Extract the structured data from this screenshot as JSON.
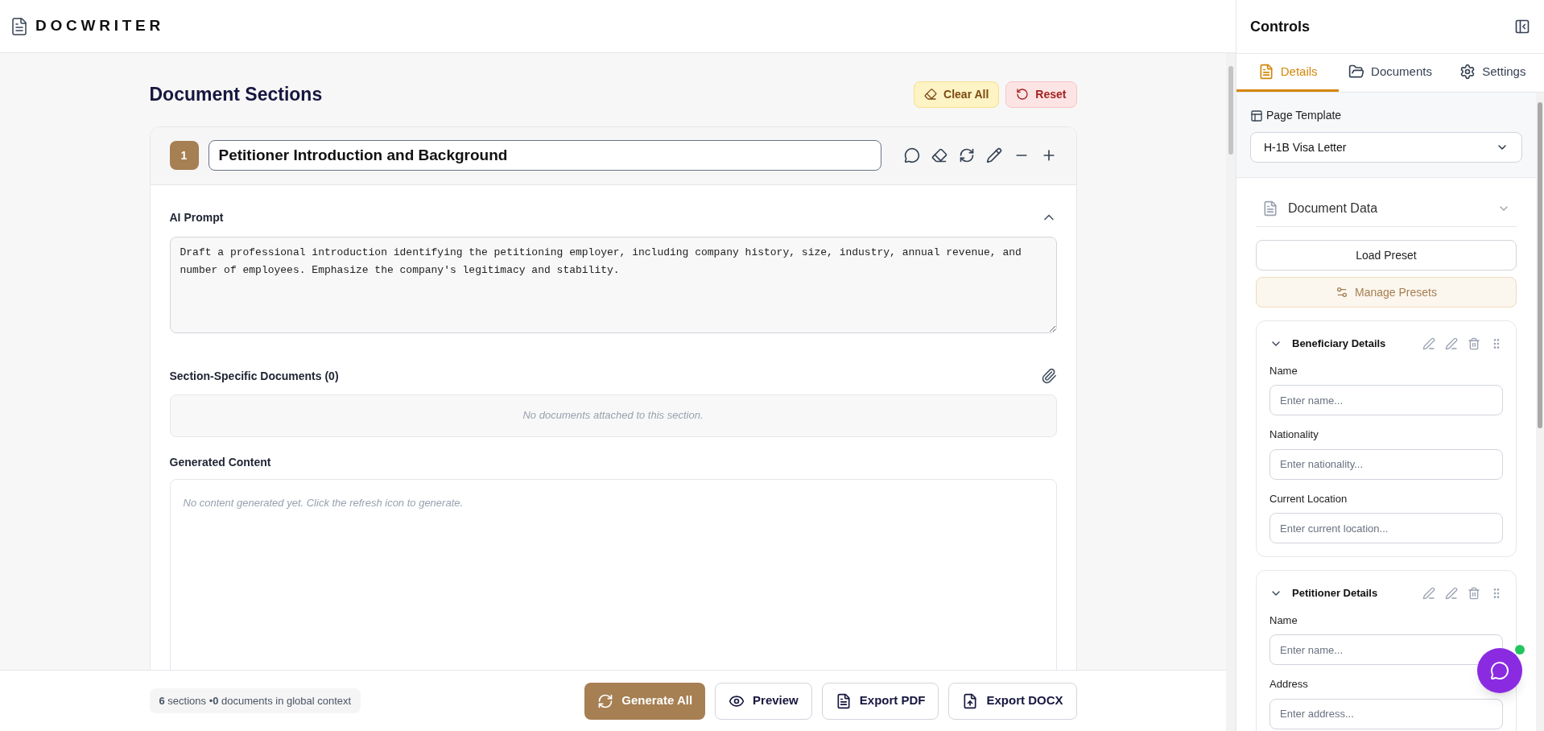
{
  "app": {
    "logo": "DOCWRITER"
  },
  "main": {
    "title": "Document Sections",
    "actions": [
      {
        "label": "Clear All",
        "kind": "clear"
      },
      {
        "label": "Reset",
        "kind": "reset"
      }
    ],
    "sections": [
      {
        "number": "1",
        "title": "Petitioner Introduction and Background",
        "prompt_label": "AI Prompt",
        "prompt_expanded": true,
        "prompt": "Draft a professional introduction identifying the petitioning employer, including company history, size, industry, annual revenue, and number of employees. Emphasize the company's legitimacy and stability.",
        "docs_label": "Section-Specific Documents (0)",
        "docs_empty": "No documents attached to this section.",
        "content_label": "Generated Content",
        "content_placeholder": "No content generated yet. Click the refresh icon to generate."
      }
    ]
  },
  "footer": {
    "summary": "**6** sections •**0** documents in global context",
    "buttons": [
      {
        "label": "Generate All",
        "kind": "generate"
      },
      {
        "label": "Preview",
        "kind": "preview"
      },
      {
        "label": "Export PDF",
        "kind": "pdf"
      },
      {
        "label": "Export DOCX",
        "kind": "docx"
      }
    ]
  },
  "panel": {
    "title": "Controls",
    "tabs": [
      {
        "label": "Details",
        "kind": "details",
        "selected": true
      },
      {
        "label": "Documents",
        "kind": "documents",
        "selected": false
      },
      {
        "label": "Settings",
        "kind": "settings",
        "selected": false
      }
    ],
    "template_label": "Page Template",
    "template_value": "H-1B Visa Letter",
    "data_title": "Document Data",
    "load_preset": "Load Preset",
    "manage_presets": "Manage Presets",
    "groups": [
      {
        "title": "Beneficiary Details",
        "expanded": true,
        "fields": [
          {
            "label": "Name",
            "placeholder": "Enter name..."
          },
          {
            "label": "Nationality",
            "placeholder": "Enter nationality..."
          },
          {
            "label": "Current Location",
            "placeholder": "Enter current location..."
          }
        ]
      },
      {
        "title": "Petitioner Details",
        "expanded": true,
        "fields": [
          {
            "label": "Name",
            "placeholder": "Enter name..."
          },
          {
            "label": "Address",
            "placeholder": "Enter address..."
          }
        ]
      }
    ]
  }
}
